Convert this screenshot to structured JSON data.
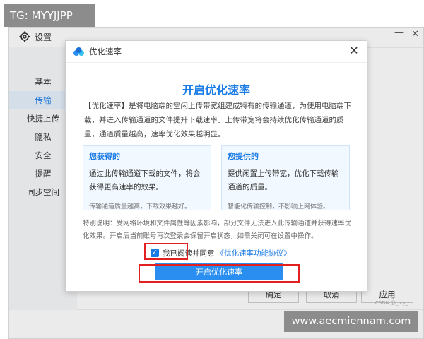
{
  "watermark_top": "TG: MYYJJPP",
  "watermark_bottom": "www.aecmiennam.com",
  "csdn_mark": "CSDN @_lcy_",
  "settings": {
    "title": "设置",
    "nav": [
      "基本",
      "传输",
      "快捷上传",
      "隐私",
      "安全",
      "提醒",
      "同步空间"
    ],
    "active_nav": "传输",
    "buttons": {
      "ok": "确定",
      "cancel": "取消",
      "apply": "应用"
    }
  },
  "modal": {
    "title": "优化速率",
    "heading": "开启优化速率",
    "description": "【优化速率】是将电脑端的空闲上传带宽组建成特有的传输通道，为使用电脑端下载，并进入传输通道的文件提升下载速率。上传带宽将会持续优化传输通道的质量，通道质量越高，速率优化效果越明显。",
    "card_left": {
      "title": "您获得的",
      "body": "通过此传输通道下载的文件，将会获得更高速率的效果。",
      "note": "传输通道质量越高，下载效果越好。"
    },
    "card_right": {
      "title": "您提供的",
      "body": "提供闲置上传带宽，优化下载传输通道的质量。",
      "note": "智能化传输控制，不影响上网体验。"
    },
    "special_note": "特别说明：受网络环境和文件属性等因素影响，部分文件无法进入此传输通道并获得速率优化效果。开启后当前账号再次登录会保留开启状态，如需关闭可在设置中操作。",
    "agree_text": "我已阅读并同意",
    "agree_link": "《优化速率功能协议》",
    "agree_checked": true,
    "enable_button": "开启优化速率"
  },
  "colors": {
    "accent": "#1a7be6",
    "button": "#2a8ef0",
    "highlight": "#e22020"
  }
}
